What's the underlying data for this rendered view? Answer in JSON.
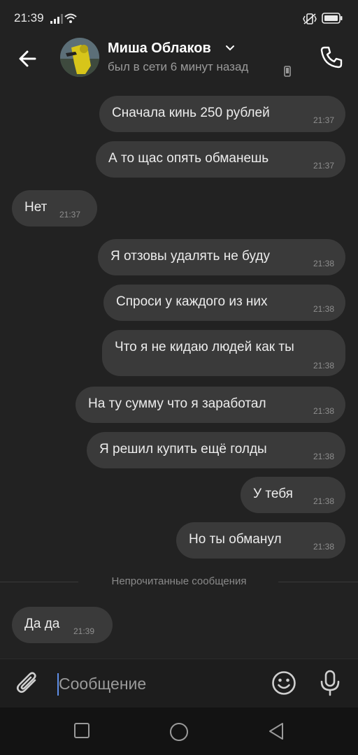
{
  "status_bar": {
    "time": "21:39"
  },
  "header": {
    "contact_name": "Миша Облаков",
    "contact_status": "был в сети 6 минут назад"
  },
  "messages": [
    {
      "side": "outgoing",
      "text": "Сначала кинь 250 рублей",
      "time": "21:37"
    },
    {
      "side": "outgoing",
      "text": "А то щас опять обманешь",
      "time": "21:37"
    },
    {
      "side": "incoming",
      "text": "Нет",
      "time": "21:37"
    },
    {
      "side": "outgoing",
      "text": "Я отзовы удалять не буду",
      "time": "21:38"
    },
    {
      "side": "outgoing",
      "text": "Спроси у каждого из них",
      "time": "21:38"
    },
    {
      "side": "outgoing",
      "text": "Что я не кидаю людей как ты",
      "time": "21:38"
    },
    {
      "side": "outgoing",
      "text": "На ту сумму что я заработал",
      "time": "21:38"
    },
    {
      "side": "outgoing",
      "text": "Я решил купить ещё голды",
      "time": "21:38"
    },
    {
      "side": "outgoing",
      "text": "У тебя",
      "time": "21:38"
    },
    {
      "side": "outgoing",
      "text": "Но ты обманул",
      "time": "21:38"
    },
    {
      "side": "incoming",
      "text": "Да да",
      "time": "21:39"
    }
  ],
  "unread_divider": "Непрочитанные сообщения",
  "composer": {
    "placeholder": "Сообщение"
  },
  "colors": {
    "background": "#222222",
    "bubble": "#3a3a3a",
    "secondary_text": "#9a9a9a",
    "caret": "#5f8fe8",
    "avatar_accent": "#d7c51a"
  },
  "icons": {
    "back": "arrow-left-icon",
    "dropdown": "chevron-down-icon",
    "device": "phone-device-icon",
    "call": "phone-call-icon",
    "attach": "paperclip-icon",
    "emoji": "smiley-icon",
    "voice": "microphone-icon",
    "nav_recent": "square-icon",
    "nav_home": "circle-icon",
    "nav_back": "triangle-back-icon"
  }
}
